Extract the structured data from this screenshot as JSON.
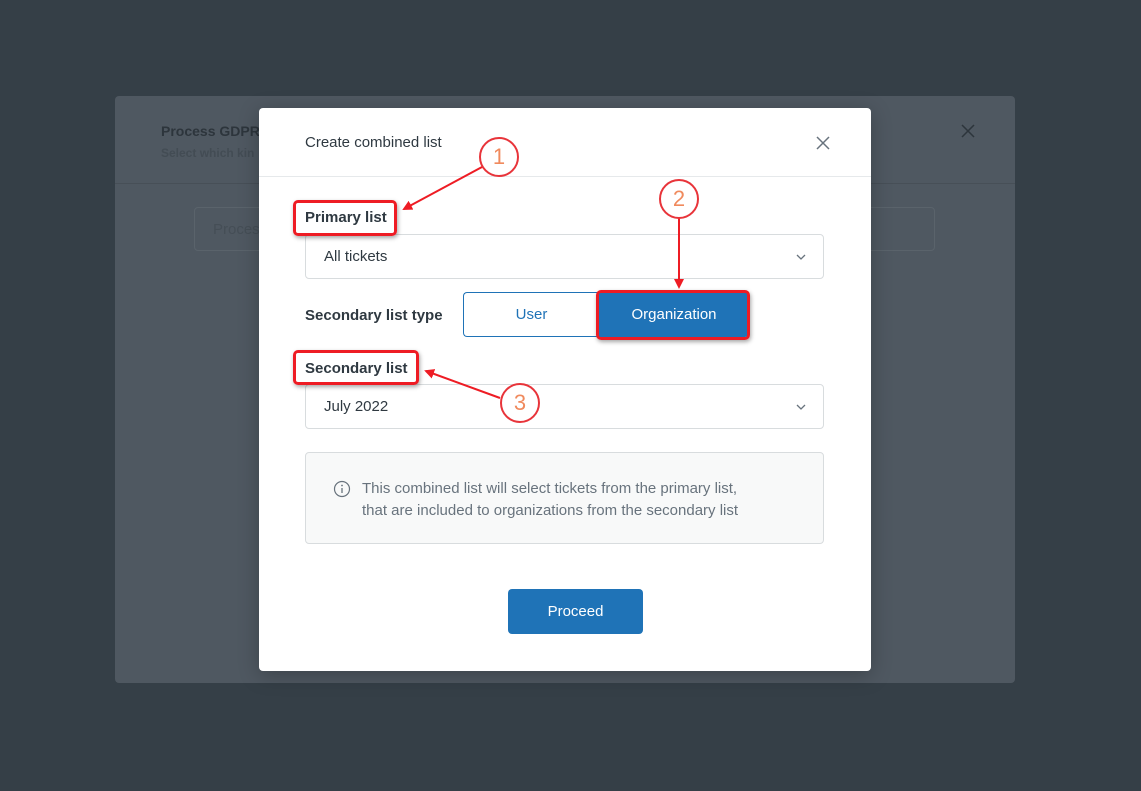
{
  "background_dialog": {
    "title": "Process GDPR",
    "subtitle": "Select which kin",
    "card_text": "Proces"
  },
  "modal": {
    "title": "Create combined list",
    "close_icon": "close-icon",
    "primary_list": {
      "label": "Primary list",
      "value": "All tickets"
    },
    "secondary_list_type": {
      "label": "Secondary list type",
      "options": [
        "User",
        "Organization"
      ],
      "selected": "Organization"
    },
    "secondary_list": {
      "label": "Secondary list",
      "value": "July 2022"
    },
    "info": {
      "icon": "info-icon",
      "line1": "This combined list will select tickets from the primary list,",
      "line2": "that are included to organizations from the secondary list"
    },
    "proceed_label": "Proceed"
  },
  "annotations": [
    {
      "number": "1",
      "target": "Primary list"
    },
    {
      "number": "2",
      "target": "Organization"
    },
    {
      "number": "3",
      "target": "Secondary list"
    }
  ],
  "colors": {
    "accent": "#1f73b7",
    "annotation": "#ee1c24",
    "backdrop": "#353f47"
  }
}
